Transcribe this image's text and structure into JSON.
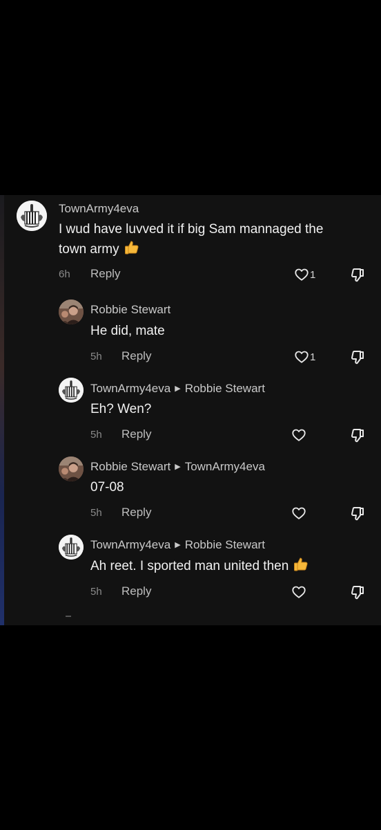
{
  "comments": [
    {
      "username": "TownArmy4eva",
      "reply_to": "",
      "text_line1": "I wud have luvved it if big Sam mannaged the",
      "text_line2": "town army",
      "time": "6h",
      "reply_label": "Reply",
      "likes": "1",
      "avatar": "newcastle-crest",
      "emoji": "thumbs-up"
    },
    {
      "username": "Robbie Stewart",
      "reply_to": "",
      "text_line1": "He did, mate",
      "time": "5h",
      "reply_label": "Reply",
      "likes": "1",
      "avatar": "person-photo"
    },
    {
      "username": "TownArmy4eva",
      "reply_to": "Robbie Stewart",
      "text_line1": "Eh? Wen?",
      "time": "5h",
      "reply_label": "Reply",
      "likes": "",
      "avatar": "newcastle-crest"
    },
    {
      "username": "Robbie Stewart",
      "reply_to": "TownArmy4eva",
      "text_line1": "07-08",
      "time": "5h",
      "reply_label": "Reply",
      "likes": "",
      "avatar": "person-photo"
    },
    {
      "username": "TownArmy4eva",
      "reply_to": "Robbie Stewart",
      "text_line1": "Ah reet. I sported man united then",
      "time": "5h",
      "reply_label": "Reply",
      "likes": "",
      "avatar": "newcastle-crest",
      "emoji": "thumbs-up"
    }
  ],
  "colors": {
    "background": "#000000",
    "panel": "#121212",
    "text": "#f1f1f1",
    "muted": "#8a8a8a"
  }
}
